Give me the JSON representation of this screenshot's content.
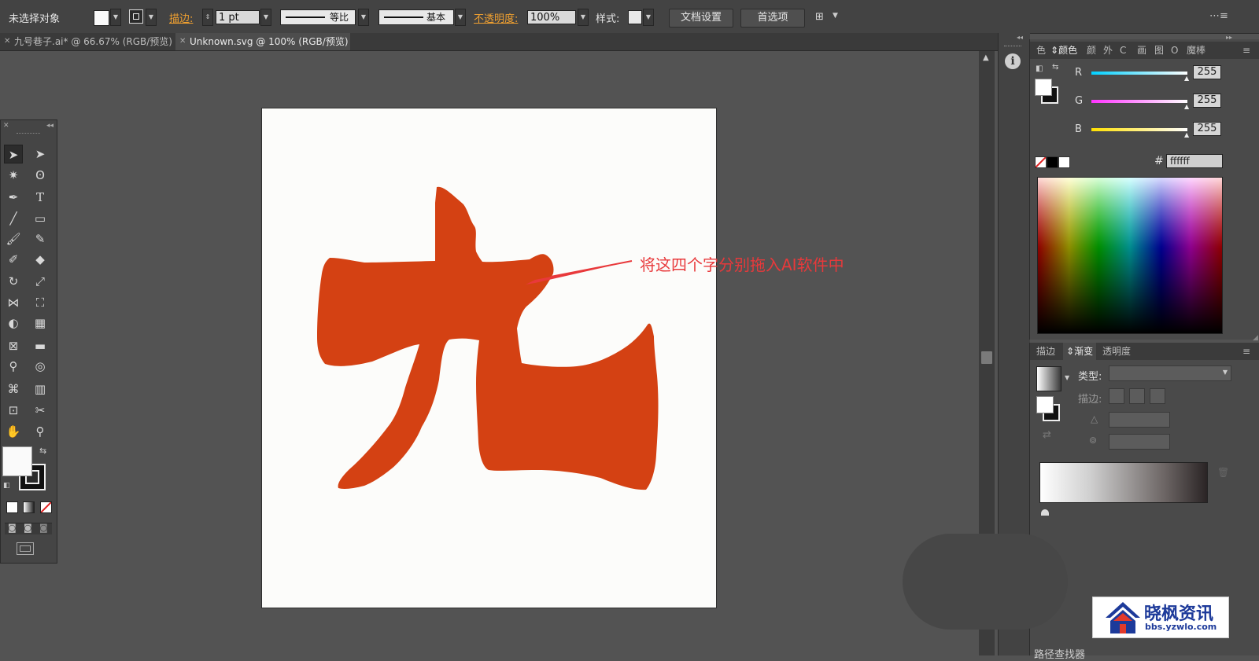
{
  "control_bar": {
    "selection_label": "未选择对象",
    "stroke_label": "描边:",
    "stroke_weight": "1 pt",
    "profile_label": "等比",
    "brush_label": "基本",
    "opacity_label": "不透明度:",
    "opacity_value": "100%",
    "style_label": "样式:",
    "doc_settings_button": "文档设置",
    "preferences_button": "首选项"
  },
  "tabs": [
    {
      "label": "九号巷子.ai* @ 66.67% (RGB/预览)",
      "active": false
    },
    {
      "label": "Unknown.svg @ 100% (RGB/预览)",
      "active": true
    }
  ],
  "annotation": {
    "text": "将这四个字分别拖入AI软件中",
    "color": "#e8393b"
  },
  "artwork": {
    "glyph": "九",
    "fill": "#d44113"
  },
  "color_panel": {
    "tabs": [
      "色",
      "颜色",
      "颜",
      "外",
      "C",
      "画",
      "图",
      "O",
      "魔棒"
    ],
    "active_tab": "颜色",
    "channels": [
      {
        "name": "R",
        "value": "255"
      },
      {
        "name": "G",
        "value": "255"
      },
      {
        "name": "B",
        "value": "255"
      }
    ],
    "hash_label": "#",
    "hex_value": "ffffff"
  },
  "gradient_panel": {
    "tabs": [
      "描边",
      "渐变",
      "透明度"
    ],
    "active_tab": "渐变",
    "type_label": "类型:",
    "stroke_label": "描边:"
  },
  "bottom_text": "路径查找器",
  "watermark": {
    "main": "晓枫资讯",
    "sub": "bbs.yzwlo.com"
  },
  "colors": {
    "accent_orange": "#f0a030",
    "app_bg": "#535353",
    "panel_bg": "#4a4a4a"
  }
}
